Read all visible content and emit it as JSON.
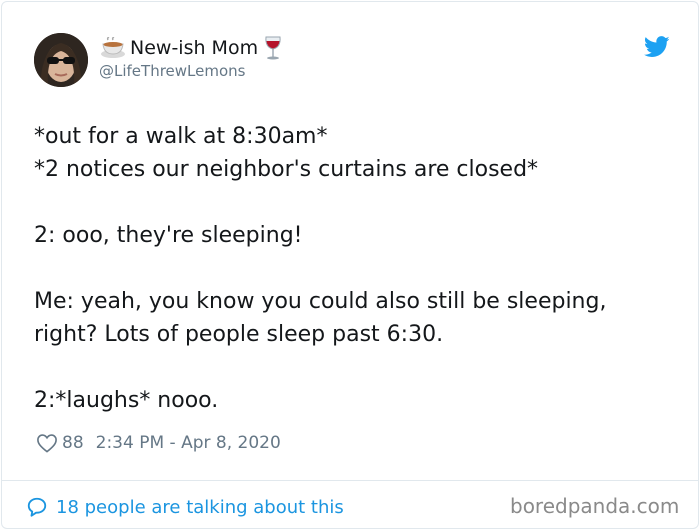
{
  "tweet": {
    "author": {
      "display_name": "New-ish Mom",
      "handle": "@LifeThrewLemons",
      "name_prefix_icon": "coffee-cup-icon",
      "name_suffix_icon": "wine-glass-icon"
    },
    "lines": [
      "*out for a walk at 8:30am*",
      "*2 notices our neighbor's curtains are closed*",
      "",
      "2: ooo, they're sleeping!",
      "",
      "Me: yeah, you know you could also still be sleeping,",
      "right? Lots of people sleep past 6:30.",
      "",
      "2:*laughs* nooo."
    ],
    "likes": "88",
    "timestamp": "2:34 PM - Apr 8, 2020",
    "conversation_link": "18 people are talking about this",
    "brand_icon": "twitter-bird-icon"
  },
  "watermark": "boredpanda.com",
  "colors": {
    "link": "#1b95e0",
    "muted": "#657786",
    "text": "#14171a",
    "twitter_blue": "#1da1f2"
  }
}
